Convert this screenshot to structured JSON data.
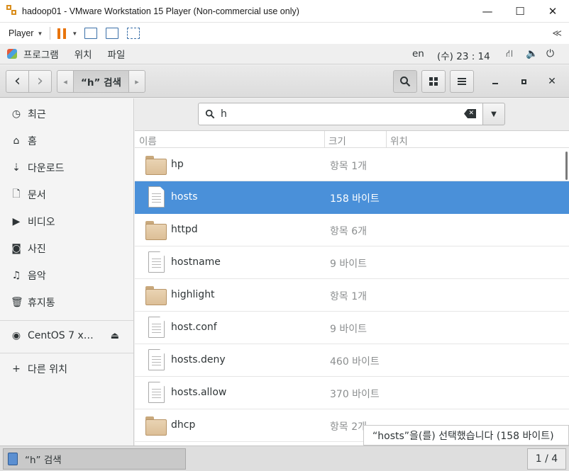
{
  "vmware": {
    "title": "hadoop01 - VMware Workstation 15 Player (Non-commercial use only)",
    "player_label": "Player",
    "collapse_glyph": "≪",
    "minimize": "—",
    "maximize": "☐",
    "close": "✕"
  },
  "gnome": {
    "menus": [
      "프로그램",
      "위치",
      "파일"
    ],
    "lang": "en",
    "clock": "(수) 23 : 14"
  },
  "header": {
    "search_title": "“h” 검색",
    "back_glyph": "‹",
    "forward_glyph": "›",
    "crumb_left": "◂",
    "crumb_right": "▸"
  },
  "sidebar": {
    "items": [
      {
        "label": "최근",
        "icon": "recent-icon"
      },
      {
        "label": "홈",
        "icon": "home-icon"
      },
      {
        "label": "다운로드",
        "icon": "download-icon"
      },
      {
        "label": "문서",
        "icon": "document-icon"
      },
      {
        "label": "비디오",
        "icon": "video-icon"
      },
      {
        "label": "사진",
        "icon": "camera-icon"
      },
      {
        "label": "음악",
        "icon": "music-icon"
      },
      {
        "label": "휴지통",
        "icon": "trash-icon"
      }
    ],
    "device": "CentOS 7 x…",
    "other": "다른 위치"
  },
  "search": {
    "query": "h"
  },
  "columns": {
    "name": "이름",
    "size": "크기",
    "location": "위치"
  },
  "files": [
    {
      "name": "hp",
      "size": "항목 1개",
      "type": "folder",
      "selected": false
    },
    {
      "name": "hosts",
      "size": "158 바이트",
      "type": "file",
      "selected": true
    },
    {
      "name": "httpd",
      "size": "항목 6개",
      "type": "folder",
      "selected": false
    },
    {
      "name": "hostname",
      "size": "9 바이트",
      "type": "file",
      "selected": false
    },
    {
      "name": "highlight",
      "size": "항목 1개",
      "type": "folder",
      "selected": false
    },
    {
      "name": "host.conf",
      "size": "9 바이트",
      "type": "file",
      "selected": false
    },
    {
      "name": "hosts.deny",
      "size": "460 바이트",
      "type": "file",
      "selected": false
    },
    {
      "name": "hosts.allow",
      "size": "370 바이트",
      "type": "file",
      "selected": false
    },
    {
      "name": "dhcp",
      "size": "항목 2개",
      "type": "folder",
      "selected": false
    }
  ],
  "status": "“hosts”을(를) 선택했습니다  (158 바이트)",
  "taskbar": {
    "window_label": "“h” 검색",
    "pager": "1 / 4"
  },
  "colors": {
    "selection": "#4a90d9",
    "pause": "#e8740c"
  }
}
